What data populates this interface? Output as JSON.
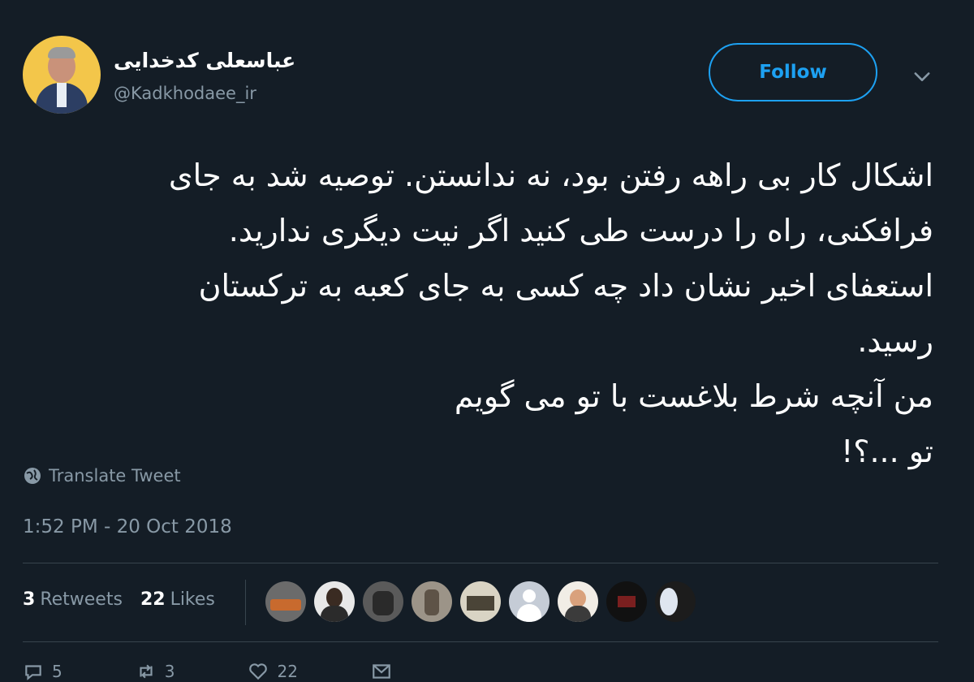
{
  "author": {
    "display_name": "عباسعلی کدخدایی",
    "handle": "@Kadkhodaee_ir"
  },
  "follow_label": "Follow",
  "tweet_lines": [
    "اشکال کار بی راهه رفتن بود، نه ندانستن. توصیه شد به جای",
    "فرافکنی، راه را درست طی کنید اگر نیت دیگری ندارید.",
    "استعفای اخیر نشان داد چه کسی به جای کعبه به ترکستان",
    "رسید.",
    "من آنچه شرط بلاغست با تو می گویم",
    "تو ...؟!"
  ],
  "translate_label": "Translate Tweet",
  "timestamp": "1:52 PM - 20 Oct 2018",
  "stats": {
    "retweets_count": "3",
    "retweets_label": "Retweets",
    "likes_count": "22",
    "likes_label": "Likes"
  },
  "actions": {
    "reply_count": "5",
    "retweet_count": "3",
    "like_count": "22"
  },
  "colors": {
    "background": "#141d26",
    "accent": "#1da1f2",
    "muted": "#8899a6",
    "divider": "#38444d"
  },
  "icons": [
    "chevron-down-icon",
    "globe-icon",
    "reply-icon",
    "retweet-icon",
    "heart-icon",
    "message-icon"
  ]
}
